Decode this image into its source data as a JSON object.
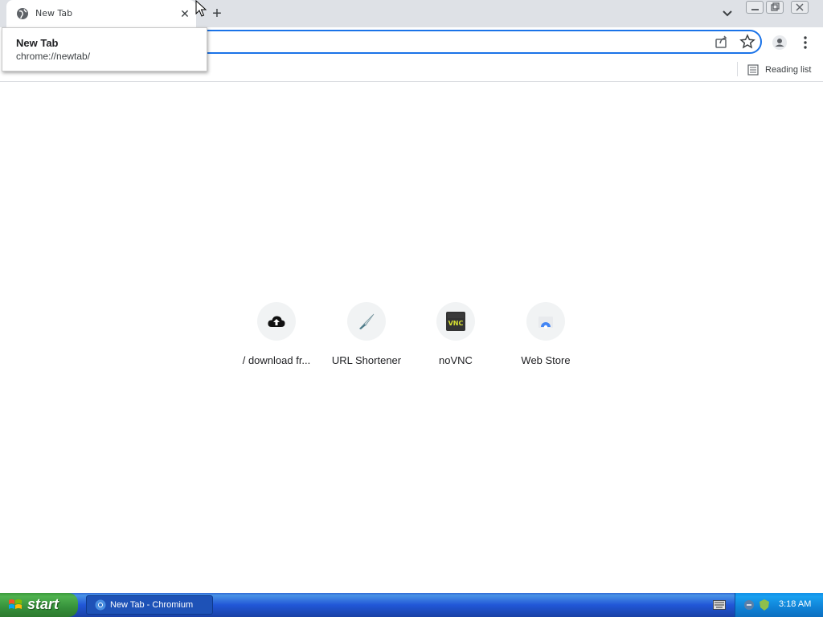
{
  "tab": {
    "title": "New Tab",
    "close_icon": "close-icon"
  },
  "popup": {
    "title": "New Tab",
    "url": "chrome://newtab/"
  },
  "bookmarks": {
    "reading_list_label": "Reading list"
  },
  "shortcuts": [
    {
      "label": "/ download fr...",
      "icon": "cloud-upload-icon"
    },
    {
      "label": "URL Shortener",
      "icon": "knife-icon"
    },
    {
      "label": "noVNC",
      "icon": "novnc-icon"
    },
    {
      "label": "Web Store",
      "icon": "web-store-icon"
    }
  ],
  "taskbar": {
    "start_label": "start",
    "task_label": "New Tab - Chromium",
    "clock": "3:18 AM"
  },
  "colors": {
    "accent": "#1a73e8",
    "taskbar": "#245edb",
    "start": "#3c9a3c"
  }
}
